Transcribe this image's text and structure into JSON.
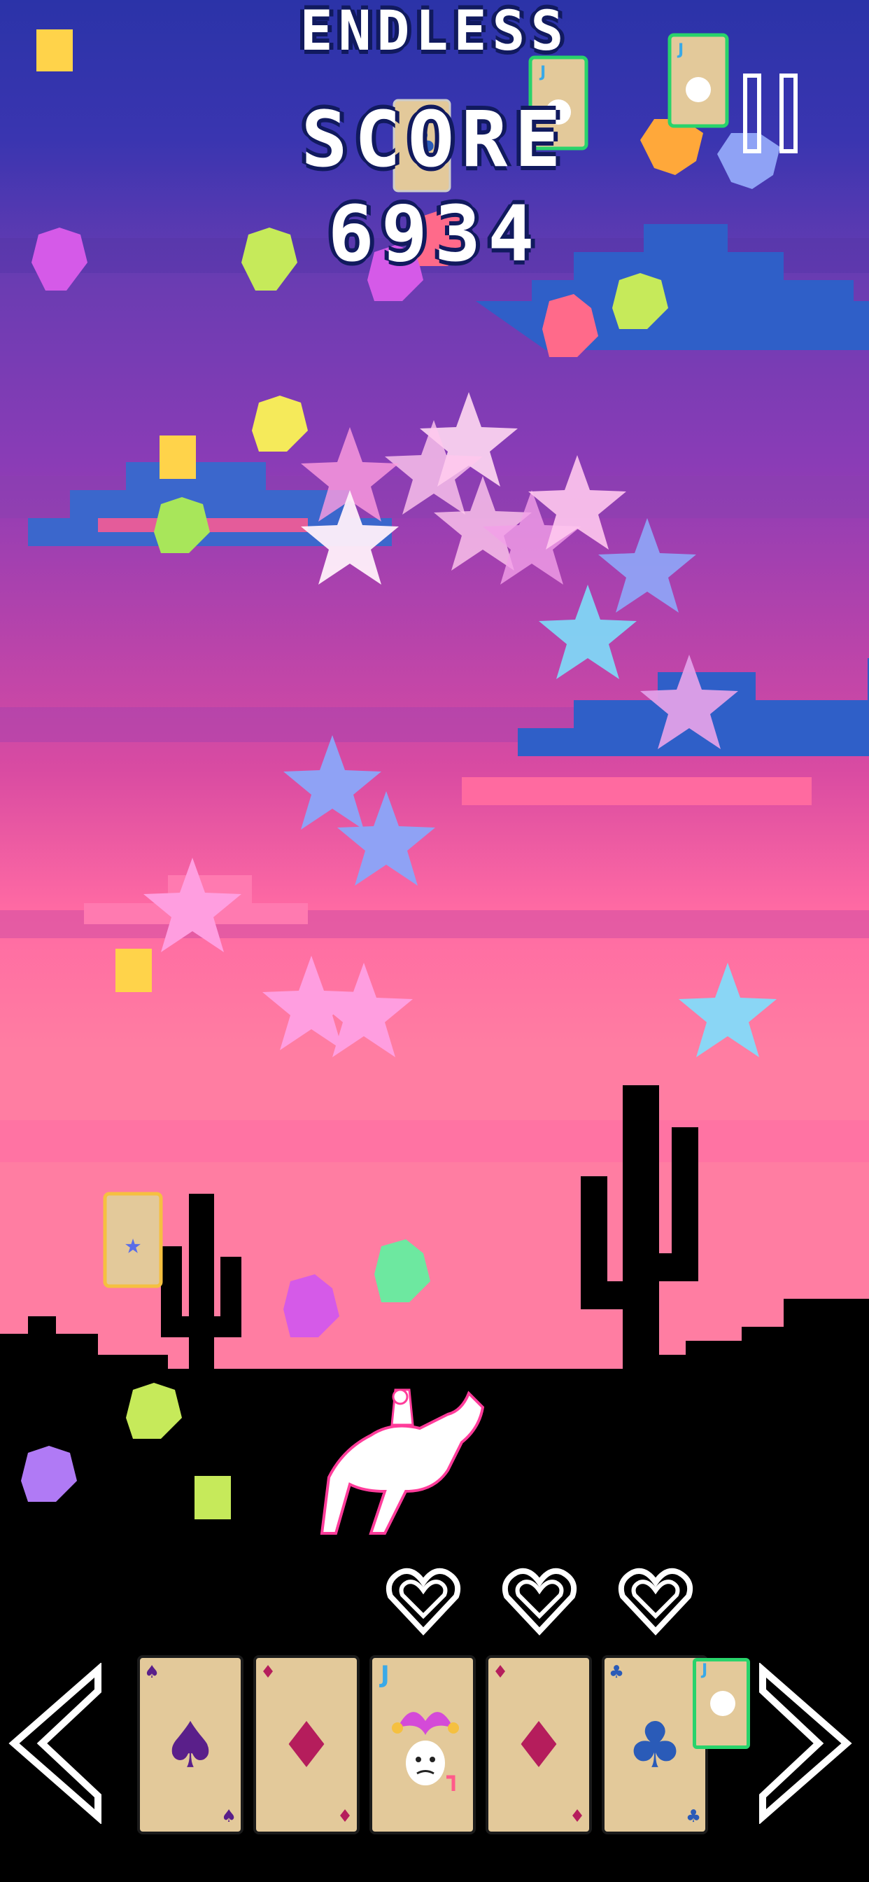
{
  "hud": {
    "mode": "ENDLESS",
    "score_label": "SCORE",
    "score_value": "6934"
  },
  "lives": {
    "hearts": 3
  },
  "hand": {
    "cards": [
      {
        "suit": "spade",
        "symbol": "♠",
        "color": "#5a1f8a"
      },
      {
        "suit": "diamond",
        "symbol": "♦",
        "color": "#b51d5c"
      },
      {
        "suit": "joker",
        "symbol": "J",
        "color": "#3aa9e8"
      },
      {
        "suit": "diamond",
        "symbol": "♦",
        "color": "#b51d5c"
      },
      {
        "suit": "club",
        "symbol": "♣",
        "color": "#2a5bb8"
      }
    ]
  },
  "palette": {
    "sky_top": "#2b33a8",
    "sky_mid": "#7b3fb0",
    "sky_low": "#e04c9b",
    "horizon": "#ff6a9c",
    "ground": "#000000",
    "card_face": "#e3c99a",
    "joker_glow": "#29d36b"
  },
  "icons": {
    "left_arrow": "chevron-left-icon",
    "right_arrow": "chevron-right-icon",
    "pause": "pause-icon",
    "heart": "heart-icon",
    "player": "horse-rider-icon"
  }
}
